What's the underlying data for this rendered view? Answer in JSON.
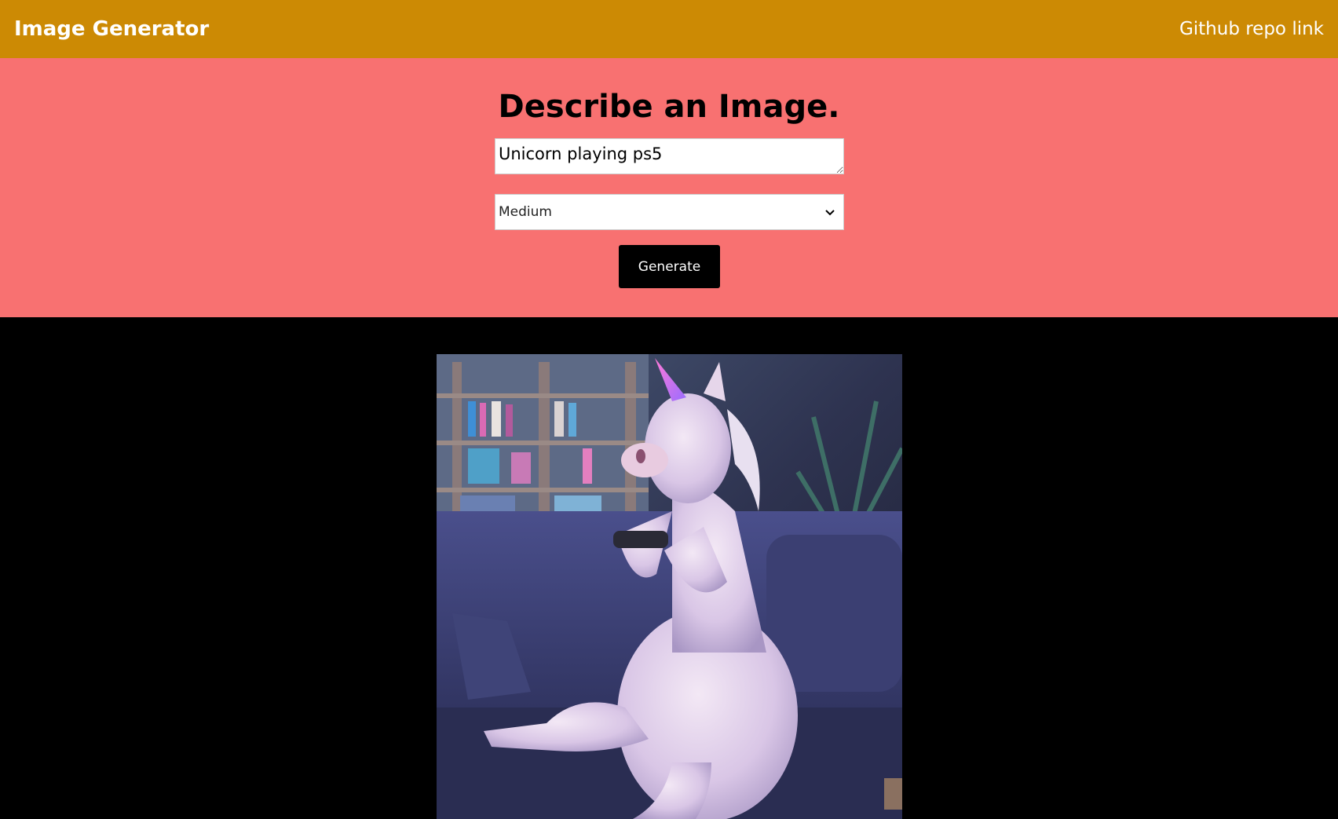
{
  "navbar": {
    "title": "Image Generator",
    "repo_link": "Github repo link"
  },
  "form": {
    "heading": "Describe an Image.",
    "prompt_value": "Unicorn playing ps5",
    "size_selected": "Medium",
    "generate_label": "Generate"
  },
  "colors": {
    "navbar_bg": "#cc8a04",
    "form_bg": "#f87171",
    "result_bg": "#000000",
    "button_bg": "#000000"
  },
  "result": {
    "image_icon": "unicorn-image"
  }
}
